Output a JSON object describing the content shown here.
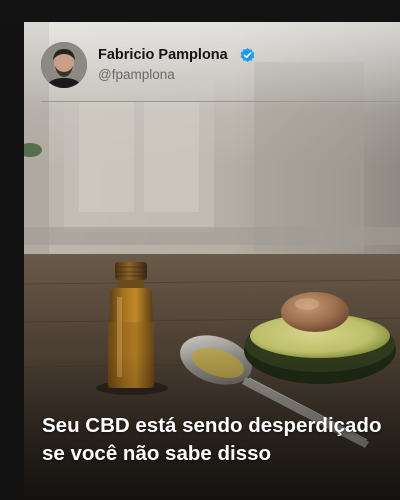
{
  "post": {
    "author": {
      "name": "Fabricio Pamplona",
      "handle": "@fpamplona",
      "verified": true
    },
    "headline": "Seu CBD está sendo desperdiçado se você não sabe disso",
    "image": {
      "subject": "amber dropper bottle with oil, metal spoon with oil, halved avocado with pit on a wooden table"
    }
  },
  "colors": {
    "verified_badge": "#1d9bf0",
    "headline_text": "#ffffff",
    "name_text": "#151515",
    "handle_text": "#6a6a6a",
    "page_background": "#121212"
  },
  "icons": {
    "verified": "verified-badge-icon"
  }
}
